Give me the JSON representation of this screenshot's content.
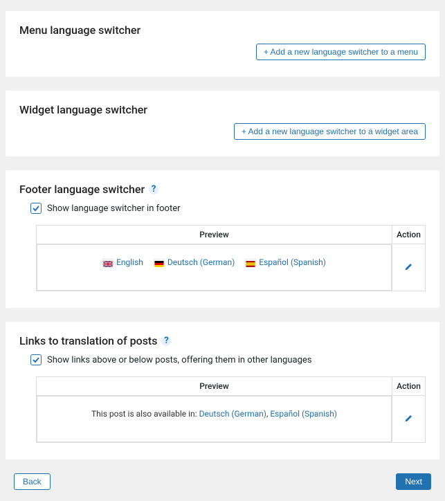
{
  "panels": {
    "menu_switcher": {
      "title": "Menu language switcher",
      "add_button": "+ Add a new language switcher to a menu"
    },
    "widget_switcher": {
      "title": "Widget language switcher",
      "add_button": "+ Add a new language switcher to a widget area"
    },
    "footer_switcher": {
      "title": "Footer language switcher",
      "checkbox_label": "Show language switcher in footer",
      "preview_header": "Preview",
      "action_header": "Action",
      "languages": {
        "en": "English",
        "de": "Deutsch (German)",
        "es": "Español (Spanish)"
      }
    },
    "translation_links": {
      "title": "Links to translation of posts",
      "checkbox_label": "Show links above or below posts, offering them in other languages",
      "preview_header": "Preview",
      "action_header": "Action",
      "intro_text": "This post is also available in: ",
      "links": {
        "de": "Deutsch (German)",
        "es": "Español (Spanish)"
      },
      "separator": ", "
    }
  },
  "nav": {
    "back": "Back",
    "next": "Next"
  }
}
